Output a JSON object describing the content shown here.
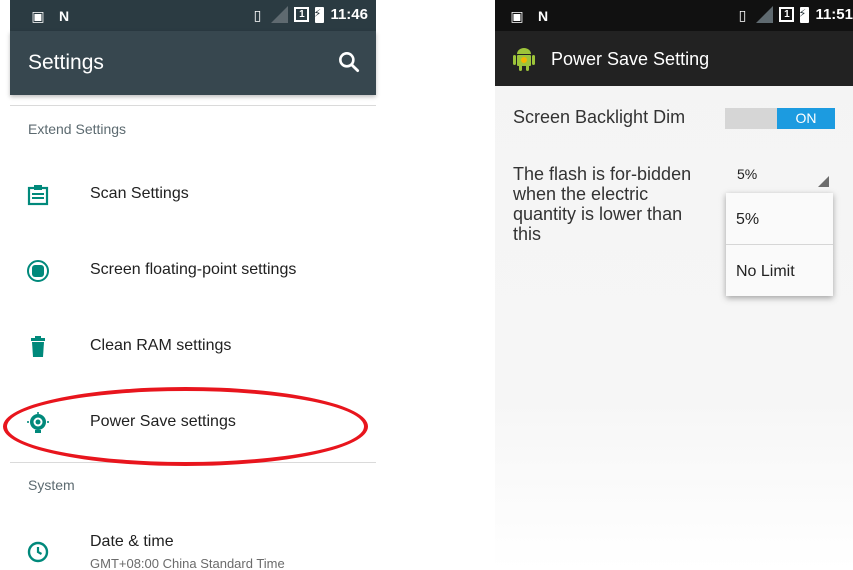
{
  "left": {
    "status_time": "11:46",
    "title": "Settings",
    "sections": [
      {
        "header": "Extend Settings",
        "items": [
          {
            "label": "Scan Settings"
          },
          {
            "label": "Screen floating-point settings"
          },
          {
            "label": "Clean RAM settings"
          },
          {
            "label": "Power Save settings"
          }
        ]
      },
      {
        "header": "System",
        "items": [
          {
            "label": "Date & time",
            "sublabel": "GMT+08:00 China Standard Time"
          }
        ]
      }
    ],
    "icons": {
      "search": "search-icon",
      "scan": "scan-settings-icon",
      "floating": "floating-point-icon",
      "clean": "trash-icon",
      "power": "power-save-icon",
      "clock": "clock-icon"
    },
    "accent_color": "#00897b",
    "highlight_color": "#e8151d"
  },
  "right": {
    "status_time": "11:51",
    "title": "Power Save Setting",
    "backlight_label": "Screen Backlight Dim",
    "toggle_state": "ON",
    "flash_label": "The flash is for-bidden when the electric quantity is lower than this",
    "spinner_value": "5%",
    "options": [
      "5%",
      "No Limit"
    ],
    "accent_color": "#1c9be0"
  }
}
